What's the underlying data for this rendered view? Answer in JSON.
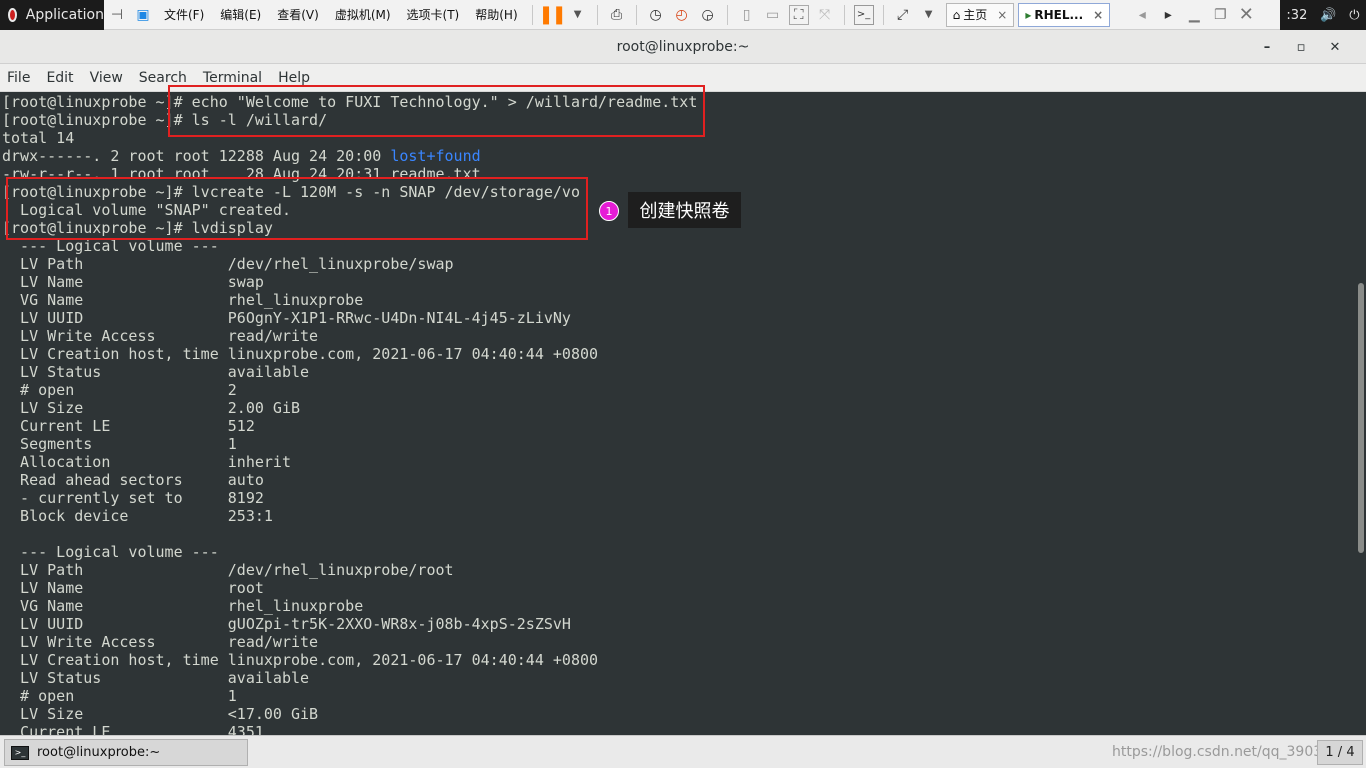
{
  "top_panel": {
    "app_menu_label": "Application",
    "vm_menus": [
      "文件(F)",
      "编辑(E)",
      "查看(V)",
      "虚拟机(M)",
      "选项卡(T)",
      "帮助(H)"
    ],
    "tabs": [
      {
        "label": "主页",
        "close": "×"
      },
      {
        "label": "RHEL...",
        "close": "×"
      }
    ],
    "clock": ":32"
  },
  "window": {
    "title": "root@linuxprobe:~",
    "controls": [
      "–",
      "▫",
      "✕"
    ]
  },
  "menubar": [
    "File",
    "Edit",
    "View",
    "Search",
    "Terminal",
    "Help"
  ],
  "terminal": {
    "lines": [
      {
        "text": "[root@linuxprobe ~]# echo \"Welcome to FUXI Technology.\" > /willard/readme.txt"
      },
      {
        "text": "[root@linuxprobe ~]# ls -l /willard/"
      },
      {
        "text": "total 14"
      },
      {
        "text": "drwx------. 2 root root 12288 Aug 24 20:00 ",
        "highlight": "lost+found"
      },
      {
        "text": "-rw-r--r--. 1 root root    28 Aug 24 20:31 readme.txt"
      },
      {
        "text": "[root@linuxprobe ~]# lvcreate -L 120M -s -n SNAP /dev/storage/vo"
      },
      {
        "text": "  Logical volume \"SNAP\" created."
      },
      {
        "text": "[root@linuxprobe ~]# lvdisplay"
      },
      {
        "text": "  --- Logical volume ---"
      },
      {
        "text": "  LV Path                /dev/rhel_linuxprobe/swap"
      },
      {
        "text": "  LV Name                swap"
      },
      {
        "text": "  VG Name                rhel_linuxprobe"
      },
      {
        "text": "  LV UUID                P6OgnY-X1P1-RRwc-U4Dn-NI4L-4j45-zLivNy"
      },
      {
        "text": "  LV Write Access        read/write"
      },
      {
        "text": "  LV Creation host, time linuxprobe.com, 2021-06-17 04:40:44 +0800"
      },
      {
        "text": "  LV Status              available"
      },
      {
        "text": "  # open                 2"
      },
      {
        "text": "  LV Size                2.00 GiB"
      },
      {
        "text": "  Current LE             512"
      },
      {
        "text": "  Segments               1"
      },
      {
        "text": "  Allocation             inherit"
      },
      {
        "text": "  Read ahead sectors     auto"
      },
      {
        "text": "  - currently set to     8192"
      },
      {
        "text": "  Block device           253:1"
      },
      {
        "text": ""
      },
      {
        "text": "  --- Logical volume ---"
      },
      {
        "text": "  LV Path                /dev/rhel_linuxprobe/root"
      },
      {
        "text": "  LV Name                root"
      },
      {
        "text": "  VG Name                rhel_linuxprobe"
      },
      {
        "text": "  LV UUID                gUOZpi-tr5K-2XXO-WR8x-j08b-4xpS-2sZSvH"
      },
      {
        "text": "  LV Write Access        read/write"
      },
      {
        "text": "  LV Creation host, time linuxprobe.com, 2021-06-17 04:40:44 +0800"
      },
      {
        "text": "  LV Status              available"
      },
      {
        "text": "  # open                 1"
      },
      {
        "text": "  LV Size                <17.00 GiB"
      },
      {
        "text": "  Current LE             4351"
      }
    ]
  },
  "annotation": {
    "badge": "1",
    "callout": "创建快照卷"
  },
  "taskbar": {
    "item_label": "root@linuxprobe:~",
    "watermark": "https://blog.csdn.net/qq_3903...",
    "pager": "1 / 4"
  },
  "colors": {
    "terminal_bg": "#2e3436",
    "terminal_fg": "#d3d7cf",
    "directory_blue": "#3a86ff",
    "annotation_red": "#e02020",
    "badge_magenta": "#e51cd6"
  }
}
